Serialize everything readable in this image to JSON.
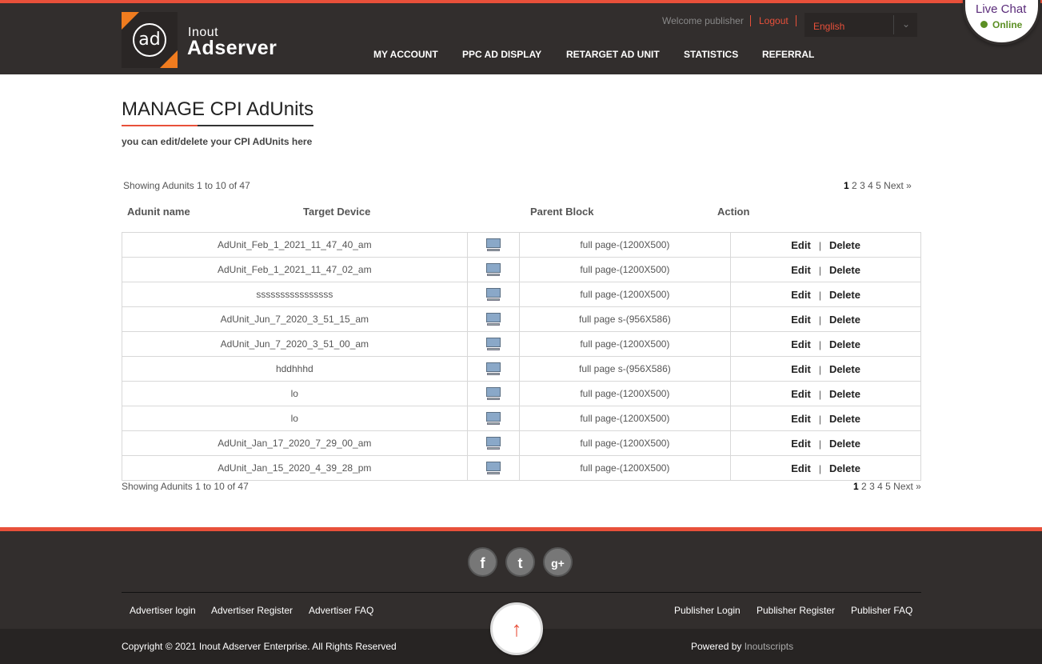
{
  "header": {
    "logo_mark": "ad",
    "logo_line1": "Inout",
    "logo_line2": "Adserver",
    "welcome": "Welcome publisher",
    "logout": "Logout",
    "language": "English",
    "nav": [
      "MY ACCOUNT",
      "PPC AD DISPLAY",
      "RETARGET AD UNIT",
      "STATISTICS",
      "REFERRAL"
    ]
  },
  "live_chat": {
    "title": "Live Chat",
    "status": "Online"
  },
  "page": {
    "title": "MANAGE CPI AdUnits",
    "subtitle": "you can edit/delete your CPI AdUnits here",
    "showing_top": "Showing Adunits 1 to 10 of 47",
    "showing_bottom": "Showing Adunits 1 to 10 of 47",
    "pager": {
      "current": "1",
      "pages": [
        "2",
        "3",
        "4",
        "5"
      ],
      "next": "Next »"
    }
  },
  "table": {
    "headers": [
      "Adunit name",
      "Target Device",
      "Parent Block",
      "Action"
    ],
    "edit_label": "Edit",
    "delete_label": "Delete",
    "rows": [
      {
        "name": "AdUnit_Feb_1_2021_11_47_40_am",
        "block": "full page-(1200X500)"
      },
      {
        "name": "AdUnit_Feb_1_2021_11_47_02_am",
        "block": "full page-(1200X500)"
      },
      {
        "name": "ssssssssssssssss",
        "block": "full page-(1200X500)"
      },
      {
        "name": "AdUnit_Jun_7_2020_3_51_15_am",
        "block": "full page s-(956X586)"
      },
      {
        "name": "AdUnit_Jun_7_2020_3_51_00_am",
        "block": "full page-(1200X500)"
      },
      {
        "name": "hddhhhd",
        "block": "full page s-(956X586)"
      },
      {
        "name": "lo",
        "block": "full page-(1200X500)"
      },
      {
        "name": "lo",
        "block": "full page-(1200X500)"
      },
      {
        "name": "AdUnit_Jan_17_2020_7_29_00_am",
        "block": "full page-(1200X500)"
      },
      {
        "name": "AdUnit_Jan_15_2020_4_39_28_pm",
        "block": "full page-(1200X500)"
      }
    ]
  },
  "footer": {
    "social": [
      "f",
      "t",
      "g+"
    ],
    "left_links": [
      "Advertiser login",
      "Advertiser Register",
      "Advertiser FAQ"
    ],
    "right_links": [
      "Publisher Login",
      "Publisher Register",
      "Publisher FAQ"
    ],
    "copyright": "Copyright © 2021 Inout Adserver Enterprise. All Rights Reserved",
    "powered_prefix": "Powered by",
    "powered_brand": "Inoutscripts",
    "to_top": "↑"
  }
}
